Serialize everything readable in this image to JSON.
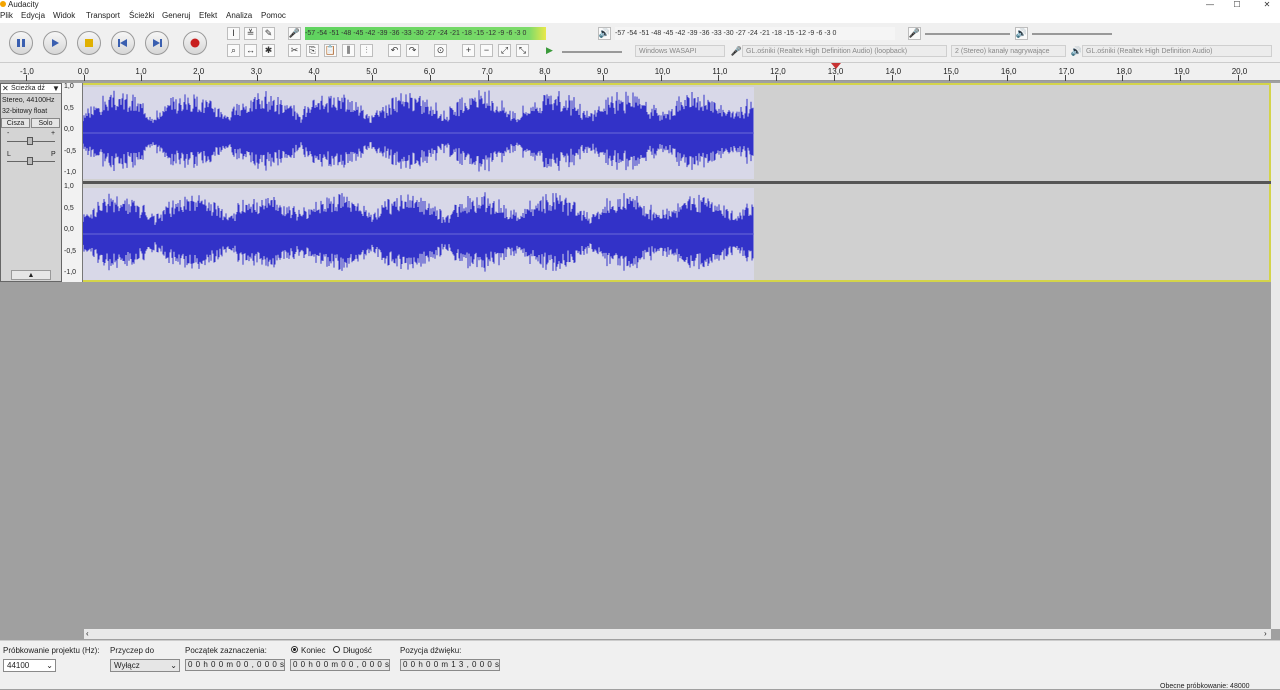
{
  "window": {
    "title": "Audacity",
    "minimize": "—",
    "maximize": "☐",
    "close": "✕"
  },
  "menu": [
    "Plik",
    "Edycja",
    "Widok",
    "Transport",
    "Ścieżki",
    "Generuj",
    "Efekt",
    "Analiza",
    "Pomoc"
  ],
  "meters": {
    "record_scale": "-57 -54 -51 -48 -45 -42 -39 -36 -33 -30 -27 -24 -21 -18 -15 -12 -9 -6 -3 0",
    "play_scale": "-57 -54 -51 -48 -45 -42 -39 -36 -33 -30 -27 -24 -21 -18 -15 -12 -9 -6 -3 0",
    "record_level_fraction": 0.86
  },
  "devices": {
    "host": "Windows WASAPI",
    "recording": "GL.ośniki (Realtek High Definition Audio) (loopback)",
    "channels": "2 (Stereo) kanały nagrywające",
    "playback": "GL.ośniki (Realtek High Definition Audio)"
  },
  "ruler": [
    "-1,0",
    "0,0",
    "1,0",
    "2,0",
    "3,0",
    "4,0",
    "5,0",
    "6,0",
    "7,0",
    "8,0",
    "9,0",
    "10,0",
    "11,0",
    "12,0",
    "13,0",
    "14,0",
    "15,0",
    "16,0",
    "17,0",
    "18,0",
    "19,0",
    "20,0"
  ],
  "track": {
    "name": "Ścieżka dź",
    "format": "Stereo, 44100Hz",
    "bits": "32-bitowy float",
    "mute": "Cisza",
    "solo": "Solo",
    "gain_left": "-",
    "gain_right": "+",
    "pan_left": "L",
    "pan_right": "P"
  },
  "vscale": [
    "1,0",
    "0,5",
    "0,0",
    "-0,5",
    "-1,0"
  ],
  "status": {
    "rate_label": "Próbkowanie projektu (Hz):",
    "rate_value": "44100",
    "snap_label": "Przyczep do",
    "snap_value": "Wyłącz",
    "sel_start_label": "Początek zaznaczenia:",
    "sel_start_value": "0 0 h 0 0 m 0 0 , 0 0 0 s",
    "end_label": "Koniec",
    "length_label": "Długość",
    "end_value": "0 0 h 0 0 m 0 0 , 0 0 0 s",
    "pos_label": "Pozycja dźwięku:",
    "pos_value": "0 0 h 0 0 m 1 3 , 0 0 0 s",
    "actual_rate": "Obecne próbkowanie: 48000"
  },
  "colors": {
    "wave": "#3232c8",
    "selection_border": "#d4d44a",
    "meter_green": "#5fd35f"
  }
}
